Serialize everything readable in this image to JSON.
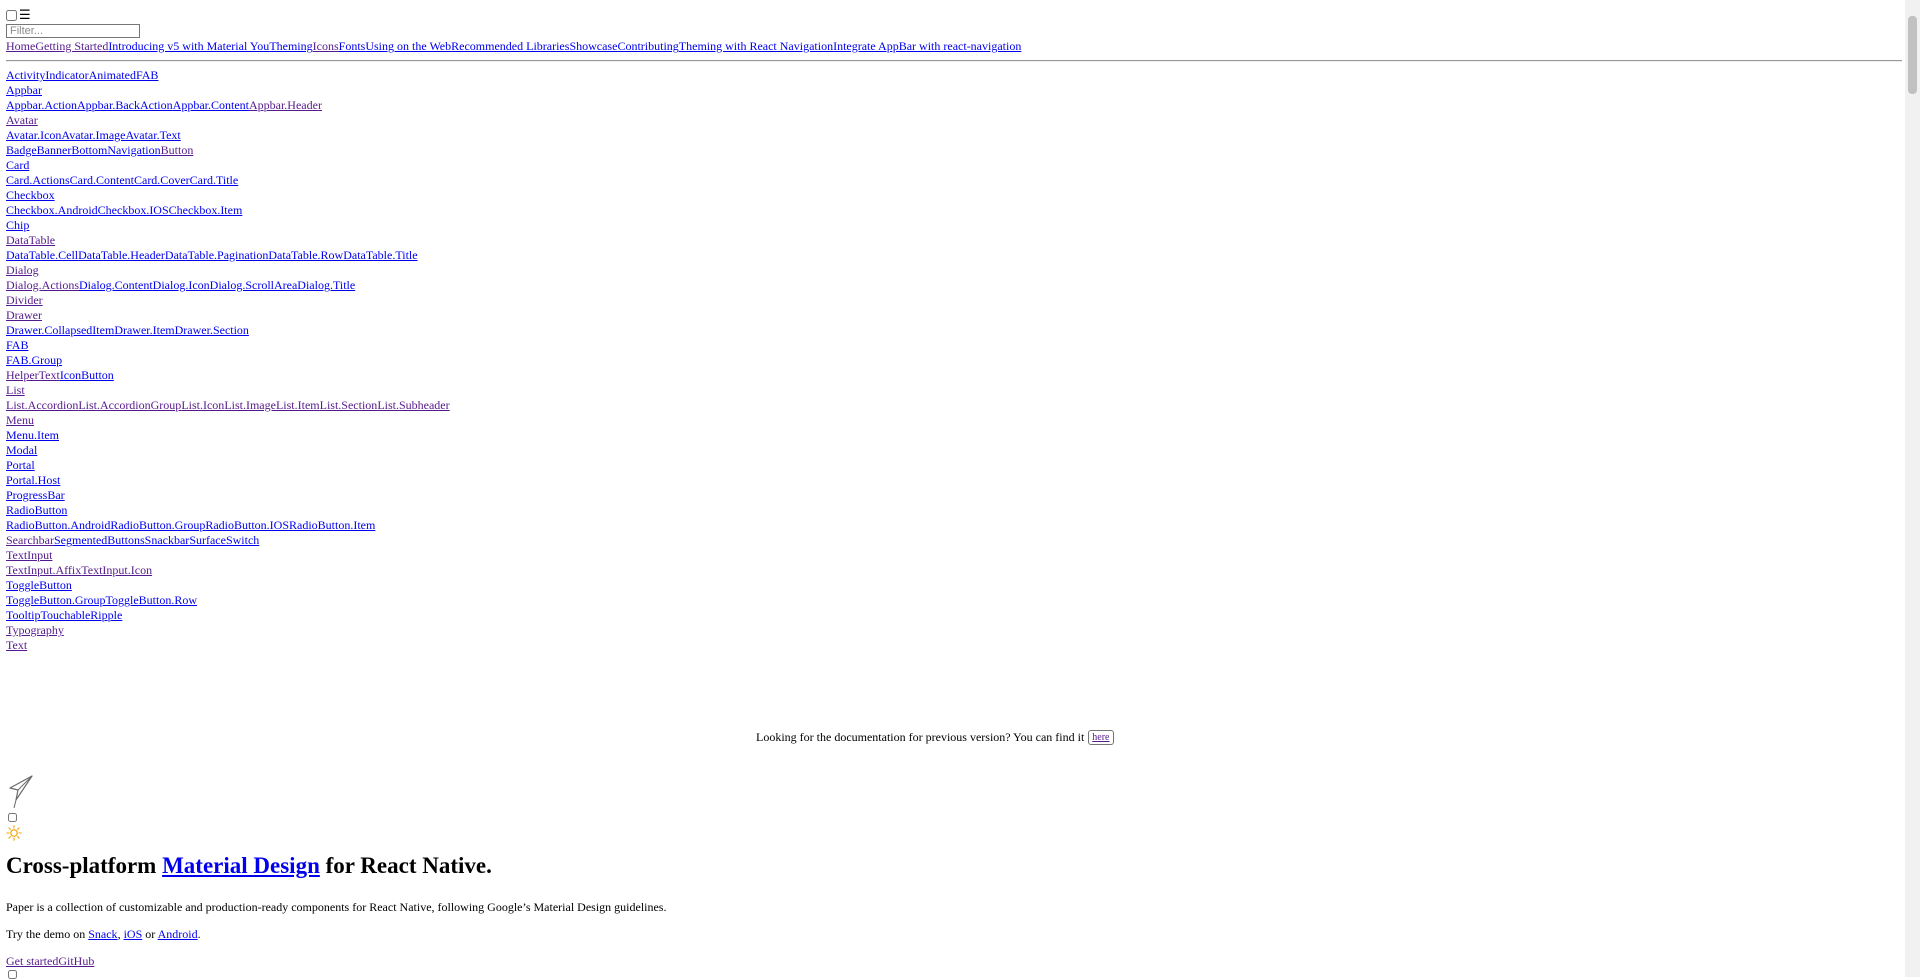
{
  "colors": {
    "link": "#0000ee",
    "visited_link": "#551a8b",
    "sun": "#f2a100"
  },
  "header": {
    "menu_icon": "☰",
    "filter_placeholder": "Filter..."
  },
  "topnav": [
    {
      "label": "Home",
      "visited": true
    },
    {
      "label": "Getting Started",
      "visited": true
    },
    {
      "label": "Introducing v5 with Material You",
      "visited": false
    },
    {
      "label": "Theming",
      "visited": false
    },
    {
      "label": "Icons",
      "visited": true
    },
    {
      "label": "Fonts",
      "visited": false
    },
    {
      "label": "Using on the Web",
      "visited": false
    },
    {
      "label": "Recommended Libraries",
      "visited": false
    },
    {
      "label": "Showcase",
      "visited": false
    },
    {
      "label": "Contributing",
      "visited": false
    },
    {
      "label": "Theming with React Navigation",
      "visited": false
    },
    {
      "label": "Integrate AppBar with react-navigation",
      "visited": false
    }
  ],
  "sidebar": [
    [
      {
        "label": "ActivityIndicator"
      },
      {
        "label": "AnimatedFAB"
      }
    ],
    [
      {
        "label": "Appbar"
      }
    ],
    [
      {
        "label": "Appbar.Action"
      },
      {
        "label": "Appbar.BackAction"
      },
      {
        "label": "Appbar.Content"
      },
      {
        "label": "Appbar.Header",
        "visited": true
      }
    ],
    [
      {
        "label": "Avatar",
        "visited": true
      }
    ],
    [
      {
        "label": "Avatar.Icon"
      },
      {
        "label": "Avatar.Image"
      },
      {
        "label": "Avatar.Text"
      }
    ],
    [
      {
        "label": "Badge"
      },
      {
        "label": "Banner"
      },
      {
        "label": "BottomNavigation"
      },
      {
        "label": "Button",
        "visited": true
      }
    ],
    [
      {
        "label": "Card"
      }
    ],
    [
      {
        "label": "Card.Actions"
      },
      {
        "label": "Card.Content"
      },
      {
        "label": "Card.Cover"
      },
      {
        "label": "Card.Title"
      }
    ],
    [
      {
        "label": "Checkbox"
      }
    ],
    [
      {
        "label": "Checkbox.Android"
      },
      {
        "label": "Checkbox.IOS"
      },
      {
        "label": "Checkbox.Item"
      }
    ],
    [
      {
        "label": "Chip"
      }
    ],
    [
      {
        "label": "DataTable",
        "visited": true
      }
    ],
    [
      {
        "label": "DataTable.Cell"
      },
      {
        "label": "DataTable.Header"
      },
      {
        "label": "DataTable.Pagination"
      },
      {
        "label": "DataTable.Row"
      },
      {
        "label": "DataTable.Title"
      }
    ],
    [
      {
        "label": "Dialog",
        "visited": true
      }
    ],
    [
      {
        "label": "Dialog.Actions",
        "visited": true
      },
      {
        "label": "Dialog.Content"
      },
      {
        "label": "Dialog.Icon"
      },
      {
        "label": "Dialog.ScrollArea"
      },
      {
        "label": "Dialog.Title"
      }
    ],
    [
      {
        "label": "Divider",
        "visited": true
      }
    ],
    [
      {
        "label": "Drawer",
        "visited": true
      }
    ],
    [
      {
        "label": "Drawer.CollapsedItem"
      },
      {
        "label": "Drawer.Item"
      },
      {
        "label": "Drawer.Section"
      }
    ],
    [
      {
        "label": "FAB"
      }
    ],
    [
      {
        "label": "FAB.Group"
      }
    ],
    [
      {
        "label": "HelperText",
        "visited": true
      },
      {
        "label": "IconButton"
      }
    ],
    [
      {
        "label": "List",
        "visited": true
      }
    ],
    [
      {
        "label": "List.Accordion",
        "visited": true
      },
      {
        "label": "List.AccordionGroup",
        "visited": true
      },
      {
        "label": "List.Icon",
        "visited": true
      },
      {
        "label": "List.Image",
        "visited": true
      },
      {
        "label": "List.Item",
        "visited": true
      },
      {
        "label": "List.Section",
        "visited": true
      },
      {
        "label": "List.Subheader",
        "visited": true
      }
    ],
    [
      {
        "label": "Menu",
        "visited": true
      }
    ],
    [
      {
        "label": "Menu.Item"
      }
    ],
    [
      {
        "label": "Modal"
      }
    ],
    [
      {
        "label": "Portal"
      }
    ],
    [
      {
        "label": "Portal.Host"
      }
    ],
    [
      {
        "label": "ProgressBar"
      }
    ],
    [
      {
        "label": "RadioButton"
      }
    ],
    [
      {
        "label": "RadioButton.Android"
      },
      {
        "label": "RadioButton.Group"
      },
      {
        "label": "RadioButton.IOS"
      },
      {
        "label": "RadioButton.Item"
      }
    ],
    [
      {
        "label": "Searchbar",
        "visited": true
      },
      {
        "label": "SegmentedButtons"
      },
      {
        "label": "Snackbar"
      },
      {
        "label": "Surface"
      },
      {
        "label": "Switch"
      }
    ],
    [
      {
        "label": "TextInput",
        "visited": true
      }
    ],
    [
      {
        "label": "TextInput.Affix",
        "visited": true
      },
      {
        "label": "TextInput.Icon",
        "visited": true
      }
    ],
    [
      {
        "label": "ToggleButton"
      }
    ],
    [
      {
        "label": "ToggleButton.Group"
      },
      {
        "label": "ToggleButton.Row"
      }
    ],
    [
      {
        "label": "Tooltip"
      },
      {
        "label": "TouchableRipple"
      }
    ],
    [
      {
        "label": "Typography",
        "visited": true
      }
    ],
    [
      {
        "label": "Text",
        "visited": true
      }
    ]
  ],
  "prev_version": {
    "text": "Looking for the documentation for previous version? You can find it",
    "button": "here"
  },
  "hero": {
    "title_before": "Cross-platform ",
    "title_link": "Material Design",
    "title_after": " for React Native.",
    "description": "Paper is a collection of customizable and production-ready components for React Native, following Google’s Material Design guidelines.",
    "demo_prefix": "Try the demo on ",
    "demo_links": [
      "Snack",
      "iOS",
      "Android"
    ],
    "demo_sep1": ", ",
    "demo_sep2": " or ",
    "demo_end": ".",
    "cta": [
      "Get started",
      "GitHub"
    ]
  }
}
